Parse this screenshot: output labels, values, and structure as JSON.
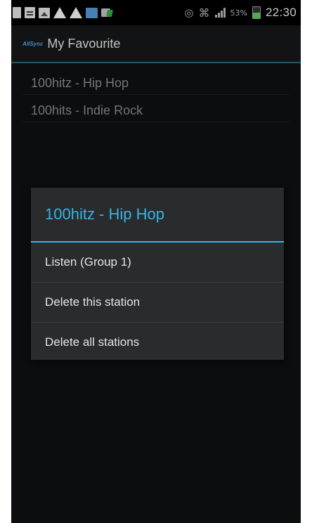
{
  "status_bar": {
    "battery_percent": "53%",
    "battery_level": 0.53,
    "time": "22:30",
    "left_icons": [
      "app-notification-icon",
      "document-icon",
      "image-icon",
      "warning-icon",
      "warning-icon",
      "picture-icon",
      "sync-icon"
    ],
    "right_icons": [
      "eye-icon",
      "wifi-icon",
      "signal-icon",
      "battery-icon"
    ]
  },
  "action_bar": {
    "logo_text": "AllSync",
    "title": "My Favourite"
  },
  "stations": [
    {
      "label": "100hitz - Hip Hop"
    },
    {
      "label": "100hits - Indie Rock"
    }
  ],
  "dialog": {
    "title": "100hitz - Hip Hop",
    "items": [
      {
        "label": "Listen (Group 1)"
      },
      {
        "label": "Delete this station"
      },
      {
        "label": "Delete all stations"
      }
    ]
  },
  "colors": {
    "accent": "#33b5e5",
    "background": "#101214",
    "dialog_background": "#2a2b2d"
  }
}
